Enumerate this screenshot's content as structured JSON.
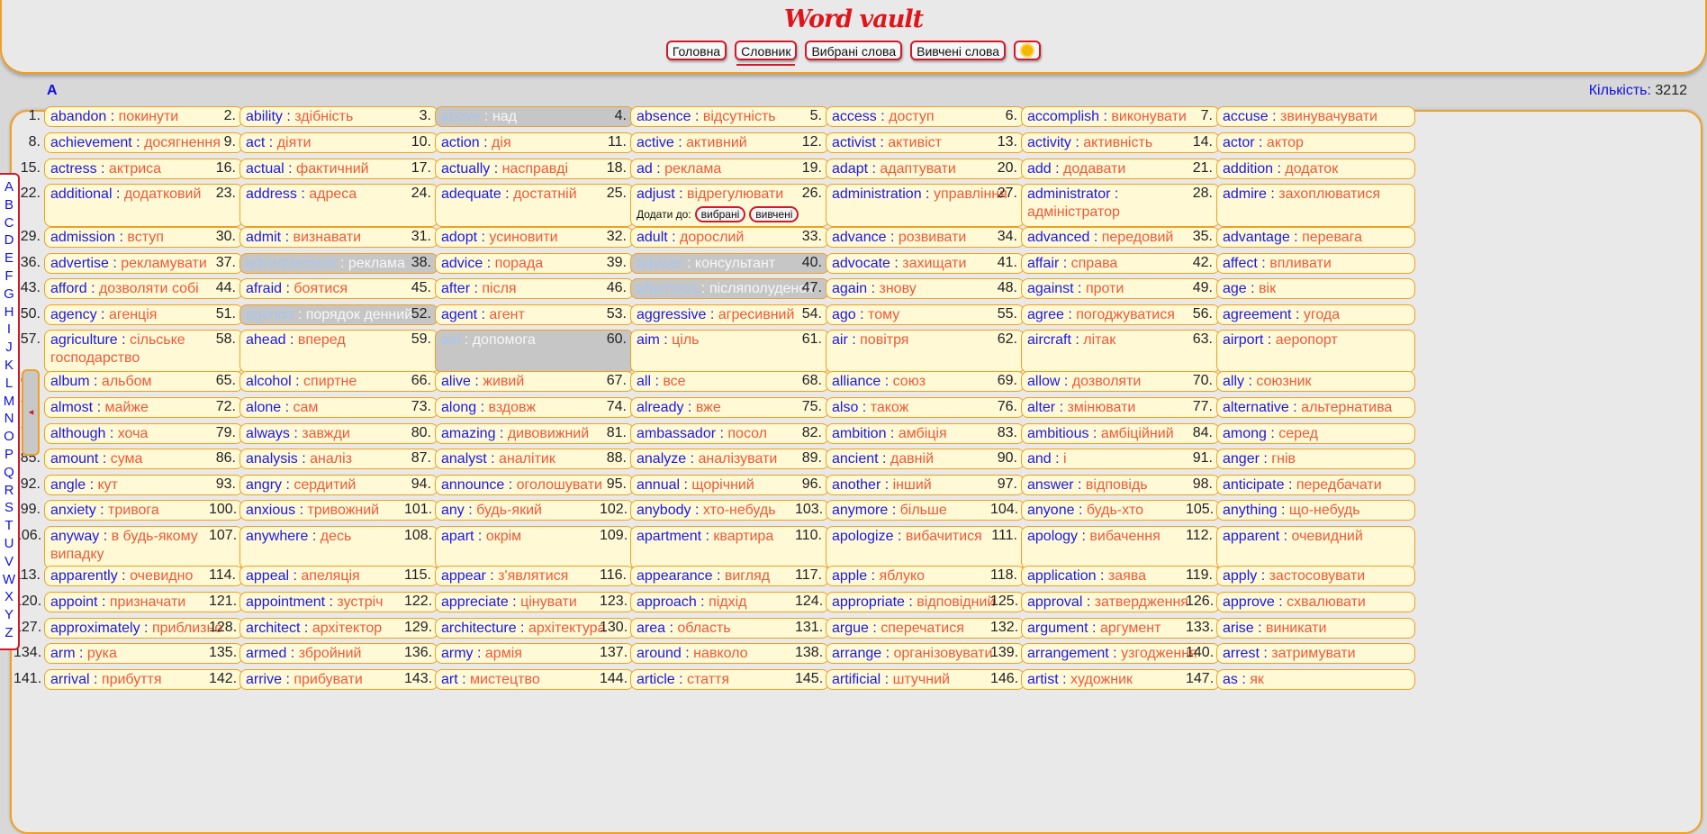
{
  "app": {
    "logo": "Word vault",
    "nav": [
      {
        "label": "Головна"
      },
      {
        "label": "Словник",
        "active": true
      },
      {
        "label": "Вибрані слова"
      },
      {
        "label": "Вивчені слова"
      }
    ],
    "theme_icon": "sun-icon"
  },
  "toolbar": {
    "current_letter": "A",
    "count_label": "Кількість:",
    "count_value": "3212"
  },
  "alphabet": [
    "A",
    "B",
    "C",
    "D",
    "E",
    "F",
    "G",
    "H",
    "I",
    "J",
    "K",
    "L",
    "M",
    "N",
    "O",
    "P",
    "Q",
    "R",
    "S",
    "T",
    "U",
    "V",
    "W",
    "X",
    "Y",
    "Z"
  ],
  "add_to": {
    "label": "Додати до:",
    "favorites": "вибрані",
    "studied": "вивчені"
  },
  "colors": {
    "accent_orange": "#f0a020",
    "brand_red": "#e0151b",
    "word_blue": "#1a1ae6",
    "translation_orange": "#ee5a3a",
    "card_bg": "#fff9d5",
    "studied_bg": "#c6c6c6"
  },
  "words": [
    {
      "n": "1.",
      "en": "abandon",
      "uk": "покинути"
    },
    {
      "n": "2.",
      "en": "ability",
      "uk": "здібність"
    },
    {
      "n": "3.",
      "en": "above",
      "uk": "над",
      "studied": true
    },
    {
      "n": "4.",
      "en": "absence",
      "uk": "відсутність"
    },
    {
      "n": "5.",
      "en": "access",
      "uk": "доступ"
    },
    {
      "n": "6.",
      "en": "accomplish",
      "uk": "виконувати"
    },
    {
      "n": "7.",
      "en": "accuse",
      "uk": "звинувачувати"
    },
    {
      "n": "8.",
      "en": "achievement",
      "uk": "досягнення"
    },
    {
      "n": "9.",
      "en": "act",
      "uk": "діяти"
    },
    {
      "n": "10.",
      "en": "action",
      "uk": "дія"
    },
    {
      "n": "11.",
      "en": "active",
      "uk": "активний"
    },
    {
      "n": "12.",
      "en": "activist",
      "uk": "активіст"
    },
    {
      "n": "13.",
      "en": "activity",
      "uk": "активність"
    },
    {
      "n": "14.",
      "en": "actor",
      "uk": "актор"
    },
    {
      "n": "15.",
      "en": "actress",
      "uk": "актриса"
    },
    {
      "n": "16.",
      "en": "actual",
      "uk": "фактичний"
    },
    {
      "n": "17.",
      "en": "actually",
      "uk": "насправді"
    },
    {
      "n": "18.",
      "en": "ad",
      "uk": "реклама"
    },
    {
      "n": "19.",
      "en": "adapt",
      "uk": "адаптувати"
    },
    {
      "n": "20.",
      "en": "add",
      "uk": "додавати"
    },
    {
      "n": "21.",
      "en": "addition",
      "uk": "додаток"
    },
    {
      "n": "22.",
      "en": "additional",
      "uk": "додатковий"
    },
    {
      "n": "23.",
      "en": "address",
      "uk": "адреса"
    },
    {
      "n": "24.",
      "en": "adequate",
      "uk": "достатній"
    },
    {
      "n": "25.",
      "en": "adjust",
      "uk": "відрегулювати",
      "expanded": true
    },
    {
      "n": "26.",
      "en": "administration",
      "uk": "управління"
    },
    {
      "n": "27.",
      "en": "administrator",
      "uk": "адміністратор"
    },
    {
      "n": "28.",
      "en": "admire",
      "uk": "захоплюватися"
    },
    {
      "n": "29.",
      "en": "admission",
      "uk": "вступ"
    },
    {
      "n": "30.",
      "en": "admit",
      "uk": "визнавати"
    },
    {
      "n": "31.",
      "en": "adopt",
      "uk": "усиновити"
    },
    {
      "n": "32.",
      "en": "adult",
      "uk": "дорослий"
    },
    {
      "n": "33.",
      "en": "advance",
      "uk": "розвивати"
    },
    {
      "n": "34.",
      "en": "advanced",
      "uk": "передовий"
    },
    {
      "n": "35.",
      "en": "advantage",
      "uk": "перевага"
    },
    {
      "n": "36.",
      "en": "advertise",
      "uk": "рекламувати"
    },
    {
      "n": "37.",
      "en": "advertisement",
      "uk": "реклама",
      "studied": true
    },
    {
      "n": "38.",
      "en": "advice",
      "uk": "порада"
    },
    {
      "n": "39.",
      "en": "adviser",
      "uk": "консультант",
      "studied": true
    },
    {
      "n": "40.",
      "en": "advocate",
      "uk": "захищати"
    },
    {
      "n": "41.",
      "en": "affair",
      "uk": "справа"
    },
    {
      "n": "42.",
      "en": "affect",
      "uk": "впливати"
    },
    {
      "n": "43.",
      "en": "afford",
      "uk": "дозволяти собі"
    },
    {
      "n": "44.",
      "en": "afraid",
      "uk": "боятися"
    },
    {
      "n": "45.",
      "en": "after",
      "uk": "після"
    },
    {
      "n": "46.",
      "en": "afternoon",
      "uk": "післяполуденок",
      "studied": true
    },
    {
      "n": "47.",
      "en": "again",
      "uk": "знову"
    },
    {
      "n": "48.",
      "en": "against",
      "uk": "проти"
    },
    {
      "n": "49.",
      "en": "age",
      "uk": "вік"
    },
    {
      "n": "50.",
      "en": "agency",
      "uk": "агенція"
    },
    {
      "n": "51.",
      "en": "agenda",
      "uk": "порядок денний",
      "studied": true
    },
    {
      "n": "52.",
      "en": "agent",
      "uk": "агент"
    },
    {
      "n": "53.",
      "en": "aggressive",
      "uk": "агресивний"
    },
    {
      "n": "54.",
      "en": "ago",
      "uk": "тому"
    },
    {
      "n": "55.",
      "en": "agree",
      "uk": "погоджуватися"
    },
    {
      "n": "56.",
      "en": "agreement",
      "uk": "угода"
    },
    {
      "n": "57.",
      "en": "agriculture",
      "uk": "сільське господарство"
    },
    {
      "n": "58.",
      "en": "ahead",
      "uk": "вперед"
    },
    {
      "n": "59.",
      "en": "aid",
      "uk": "допомога",
      "studied": true
    },
    {
      "n": "60.",
      "en": "aim",
      "uk": "ціль"
    },
    {
      "n": "61.",
      "en": "air",
      "uk": "повітря"
    },
    {
      "n": "62.",
      "en": "aircraft",
      "uk": "літак"
    },
    {
      "n": "63.",
      "en": "airport",
      "uk": "аеропорт"
    },
    {
      "n": "64.",
      "en": "album",
      "uk": "альбом"
    },
    {
      "n": "65.",
      "en": "alcohol",
      "uk": "спиртне"
    },
    {
      "n": "66.",
      "en": "alive",
      "uk": "живий"
    },
    {
      "n": "67.",
      "en": "all",
      "uk": "все"
    },
    {
      "n": "68.",
      "en": "alliance",
      "uk": "союз"
    },
    {
      "n": "69.",
      "en": "allow",
      "uk": "дозволяти"
    },
    {
      "n": "70.",
      "en": "ally",
      "uk": "союзник"
    },
    {
      "n": "71.",
      "en": "almost",
      "uk": "майже"
    },
    {
      "n": "72.",
      "en": "alone",
      "uk": "сам"
    },
    {
      "n": "73.",
      "en": "along",
      "uk": "вздовж"
    },
    {
      "n": "74.",
      "en": "already",
      "uk": "вже"
    },
    {
      "n": "75.",
      "en": "also",
      "uk": "також"
    },
    {
      "n": "76.",
      "en": "alter",
      "uk": "змінювати"
    },
    {
      "n": "77.",
      "en": "alternative",
      "uk": "альтернатива"
    },
    {
      "n": "78.",
      "en": "although",
      "uk": "хоча"
    },
    {
      "n": "79.",
      "en": "always",
      "uk": "завжди"
    },
    {
      "n": "80.",
      "en": "amazing",
      "uk": "дивовижний"
    },
    {
      "n": "81.",
      "en": "ambassador",
      "uk": "посол"
    },
    {
      "n": "82.",
      "en": "ambition",
      "uk": "амбіція"
    },
    {
      "n": "83.",
      "en": "ambitious",
      "uk": "амбіційний"
    },
    {
      "n": "84.",
      "en": "among",
      "uk": "серед"
    },
    {
      "n": "85.",
      "en": "amount",
      "uk": "сума"
    },
    {
      "n": "86.",
      "en": "analysis",
      "uk": "аналіз"
    },
    {
      "n": "87.",
      "en": "analyst",
      "uk": "аналітик"
    },
    {
      "n": "88.",
      "en": "analyze",
      "uk": "аналізувати"
    },
    {
      "n": "89.",
      "en": "ancient",
      "uk": "давній"
    },
    {
      "n": "90.",
      "en": "and",
      "uk": "і"
    },
    {
      "n": "91.",
      "en": "anger",
      "uk": "гнів"
    },
    {
      "n": "92.",
      "en": "angle",
      "uk": "кут"
    },
    {
      "n": "93.",
      "en": "angry",
      "uk": "сердитий"
    },
    {
      "n": "94.",
      "en": "announce",
      "uk": "оголошувати"
    },
    {
      "n": "95.",
      "en": "annual",
      "uk": "щорічний"
    },
    {
      "n": "96.",
      "en": "another",
      "uk": "інший"
    },
    {
      "n": "97.",
      "en": "answer",
      "uk": "відповідь"
    },
    {
      "n": "98.",
      "en": "anticipate",
      "uk": "передбачати"
    },
    {
      "n": "99.",
      "en": "anxiety",
      "uk": "тривога"
    },
    {
      "n": "100.",
      "en": "anxious",
      "uk": "тривожний"
    },
    {
      "n": "101.",
      "en": "any",
      "uk": "будь-який"
    },
    {
      "n": "102.",
      "en": "anybody",
      "uk": "хто-небудь"
    },
    {
      "n": "103.",
      "en": "anymore",
      "uk": "більше"
    },
    {
      "n": "104.",
      "en": "anyone",
      "uk": "будь-хто"
    },
    {
      "n": "105.",
      "en": "anything",
      "uk": "що-небудь"
    },
    {
      "n": "106.",
      "en": "anyway",
      "uk": "в будь-якому випадку"
    },
    {
      "n": "107.",
      "en": "anywhere",
      "uk": "десь"
    },
    {
      "n": "108.",
      "en": "apart",
      "uk": "окрім"
    },
    {
      "n": "109.",
      "en": "apartment",
      "uk": "квартира"
    },
    {
      "n": "110.",
      "en": "apologize",
      "uk": "вибачитися"
    },
    {
      "n": "111.",
      "en": "apology",
      "uk": "вибачення"
    },
    {
      "n": "112.",
      "en": "apparent",
      "uk": "очевидний"
    },
    {
      "n": "113.",
      "en": "apparently",
      "uk": "очевидно"
    },
    {
      "n": "114.",
      "en": "appeal",
      "uk": "апеляція"
    },
    {
      "n": "115.",
      "en": "appear",
      "uk": "з'являтися"
    },
    {
      "n": "116.",
      "en": "appearance",
      "uk": "вигляд"
    },
    {
      "n": "117.",
      "en": "apple",
      "uk": "яблуко"
    },
    {
      "n": "118.",
      "en": "application",
      "uk": "заява"
    },
    {
      "n": "119.",
      "en": "apply",
      "uk": "застосовувати"
    },
    {
      "n": "120.",
      "en": "appoint",
      "uk": "призначати"
    },
    {
      "n": "121.",
      "en": "appointment",
      "uk": "зустріч"
    },
    {
      "n": "122.",
      "en": "appreciate",
      "uk": "цінувати"
    },
    {
      "n": "123.",
      "en": "approach",
      "uk": "підхід"
    },
    {
      "n": "124.",
      "en": "appropriate",
      "uk": "відповідний"
    },
    {
      "n": "125.",
      "en": "approval",
      "uk": "затвердження"
    },
    {
      "n": "126.",
      "en": "approve",
      "uk": "схвалювати"
    },
    {
      "n": "127.",
      "en": "approximately",
      "uk": "приблизно"
    },
    {
      "n": "128.",
      "en": "architect",
      "uk": "архітектор"
    },
    {
      "n": "129.",
      "en": "architecture",
      "uk": "архітектура"
    },
    {
      "n": "130.",
      "en": "area",
      "uk": "область"
    },
    {
      "n": "131.",
      "en": "argue",
      "uk": "сперечатися"
    },
    {
      "n": "132.",
      "en": "argument",
      "uk": "аргумент"
    },
    {
      "n": "133.",
      "en": "arise",
      "uk": "виникати"
    },
    {
      "n": "134.",
      "en": "arm",
      "uk": "рука"
    },
    {
      "n": "135.",
      "en": "armed",
      "uk": "збройний"
    },
    {
      "n": "136.",
      "en": "army",
      "uk": "армія"
    },
    {
      "n": "137.",
      "en": "around",
      "uk": "навколо"
    },
    {
      "n": "138.",
      "en": "arrange",
      "uk": "організовувати"
    },
    {
      "n": "139.",
      "en": "arrangement",
      "uk": "узгодження"
    },
    {
      "n": "140.",
      "en": "arrest",
      "uk": "затримувати"
    },
    {
      "n": "141.",
      "en": "arrival",
      "uk": "прибуття"
    },
    {
      "n": "142.",
      "en": "arrive",
      "uk": "прибувати"
    },
    {
      "n": "143.",
      "en": "art",
      "uk": "мистецтво"
    },
    {
      "n": "144.",
      "en": "article",
      "uk": "стаття"
    },
    {
      "n": "145.",
      "en": "artificial",
      "uk": "штучний"
    },
    {
      "n": "146.",
      "en": "artist",
      "uk": "художник"
    },
    {
      "n": "147.",
      "en": "as",
      "uk": "як"
    }
  ]
}
